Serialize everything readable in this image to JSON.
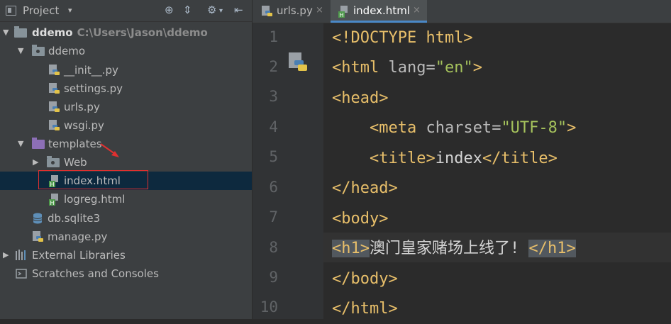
{
  "sidebar": {
    "header": {
      "title": "Project",
      "caret": "▾"
    },
    "tree": [
      {
        "label": "ddemo",
        "path": "C:\\Users\\Jason\\ddemo"
      },
      {
        "label": "ddemo"
      },
      {
        "label": "__init__.py"
      },
      {
        "label": "settings.py"
      },
      {
        "label": "urls.py"
      },
      {
        "label": "wsgi.py"
      },
      {
        "label": "templates"
      },
      {
        "label": "Web"
      },
      {
        "label": "index.html"
      },
      {
        "label": "logreg.html"
      },
      {
        "label": "db.sqlite3"
      },
      {
        "label": "manage.py"
      },
      {
        "label": "External Libraries"
      },
      {
        "label": "Scratches and Consoles"
      }
    ]
  },
  "editor": {
    "tabs": [
      {
        "label": "urls.py",
        "close": "×"
      },
      {
        "label": "index.html",
        "close": "×"
      }
    ],
    "line_numbers": [
      "1",
      "2",
      "3",
      "4",
      "5",
      "6",
      "7",
      "8",
      "9",
      "10"
    ],
    "lines": [
      [
        "<!DOCTYPE html>"
      ],
      [
        "<html",
        " lang",
        "=",
        "\"en\"",
        ">"
      ],
      [
        "<head>"
      ],
      [
        "    ",
        "<meta",
        " charset",
        "=",
        "\"UTF-8\"",
        ">"
      ],
      [
        "    ",
        "<title>",
        "index",
        "</title>"
      ],
      [
        "</head>"
      ],
      [
        "<body>"
      ],
      [
        "<h1>",
        "澳门皇家赌场上线了!",
        " ",
        "</h1>"
      ],
      [
        "</body>"
      ],
      [
        "</html>"
      ]
    ]
  },
  "colors": {
    "accent": "#4a88c7",
    "annotation": "#e03030"
  }
}
